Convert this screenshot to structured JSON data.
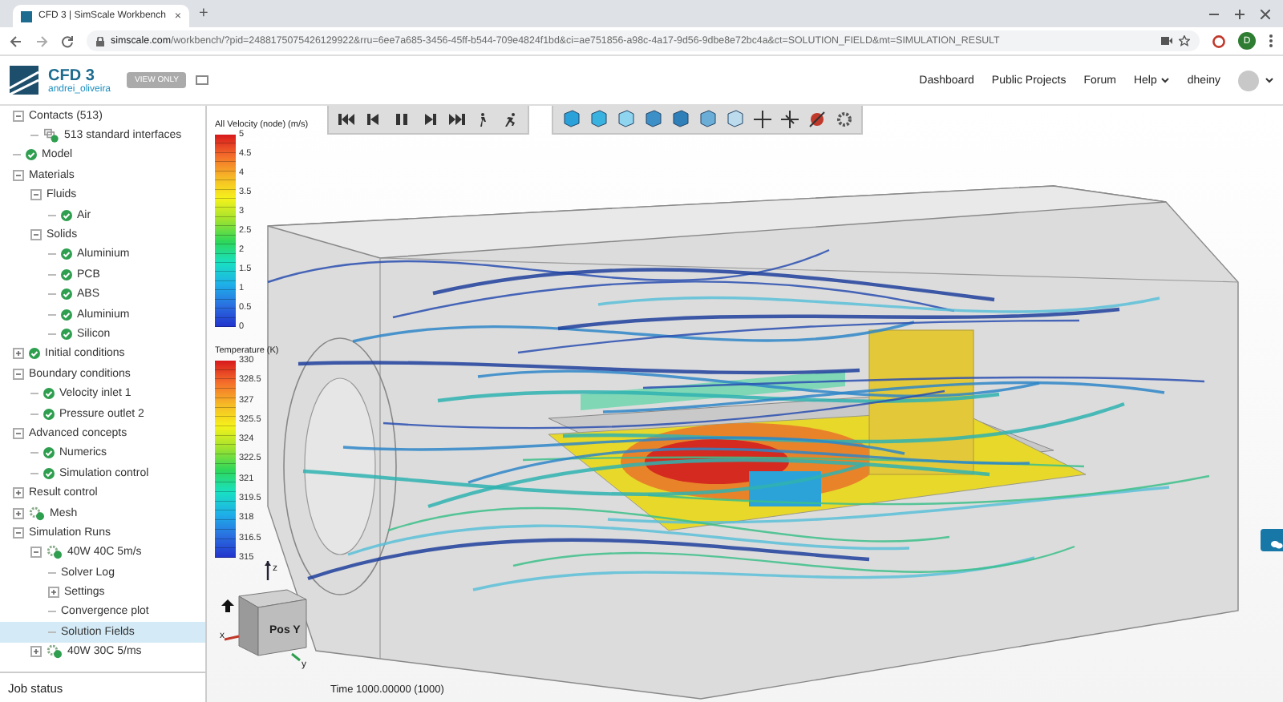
{
  "browser": {
    "tab_title": "CFD 3 | SimScale Workbench",
    "tab_close": "×",
    "new_tab": "+",
    "url_domain": "simscale.com",
    "url_path": "/workbench/?pid=2488175075426129922&rru=6ee7a685-3456-45ff-b544-709e4824f1bd&ci=ae751856-a98c-4a17-9d56-9dbe8e72bc4a&ct=SOLUTION_FIELD&mt=SIMULATION_RESULT",
    "profile_initial": "D"
  },
  "header": {
    "project": "CFD 3",
    "owner": "andrei_oliveira",
    "view_only": "VIEW ONLY",
    "nav": [
      "Dashboard",
      "Public Projects",
      "Forum",
      "Help"
    ],
    "user": "dheiny"
  },
  "tree": [
    {
      "label": "Contacts (513)",
      "kind": "plain",
      "expanded": true,
      "selected": false,
      "children": [
        {
          "label": "513 standard interfaces",
          "kind": "contacts",
          "selected": false
        }
      ]
    },
    {
      "label": "Model",
      "kind": "check",
      "selected": false
    },
    {
      "label": "Materials",
      "kind": "plain",
      "expanded": true,
      "selected": false,
      "children": [
        {
          "label": "Fluids",
          "kind": "plain",
          "expanded": true,
          "selected": false,
          "children": [
            {
              "label": "Air",
              "kind": "check",
              "selected": false
            }
          ]
        },
        {
          "label": "Solids",
          "kind": "plain",
          "expanded": true,
          "selected": false,
          "children": [
            {
              "label": "Aluminium",
              "kind": "check",
              "selected": false
            },
            {
              "label": "PCB",
              "kind": "check",
              "selected": false
            },
            {
              "label": "ABS",
              "kind": "check",
              "selected": false
            },
            {
              "label": "Aluminium",
              "kind": "check",
              "selected": false
            },
            {
              "label": "Silicon",
              "kind": "check",
              "selected": false
            }
          ]
        }
      ]
    },
    {
      "label": "Initial conditions",
      "kind": "check",
      "expanded": false,
      "selected": false
    },
    {
      "label": "Boundary conditions",
      "kind": "plain",
      "expanded": true,
      "selected": false,
      "children": [
        {
          "label": "Velocity inlet 1",
          "kind": "check",
          "selected": false
        },
        {
          "label": "Pressure outlet 2",
          "kind": "check",
          "selected": false
        }
      ]
    },
    {
      "label": "Advanced concepts",
      "kind": "plain",
      "expanded": true,
      "selected": false,
      "children": [
        {
          "label": "Numerics",
          "kind": "check",
          "selected": false
        },
        {
          "label": "Simulation control",
          "kind": "check",
          "selected": false
        }
      ]
    },
    {
      "label": "Result control",
      "kind": "plain",
      "expanded": false,
      "selected": false
    },
    {
      "label": "Mesh",
      "kind": "gear",
      "expanded": false,
      "selected": false
    },
    {
      "label": "Simulation Runs",
      "kind": "plain",
      "expanded": true,
      "selected": false,
      "children": [
        {
          "label": "40W 40C 5m/s",
          "kind": "gear",
          "expanded": true,
          "selected": false,
          "children": [
            {
              "label": "Solver Log",
              "kind": "plain",
              "selected": false
            },
            {
              "label": "Settings",
              "kind": "plain",
              "expanded": false,
              "selected": false
            },
            {
              "label": "Convergence plot",
              "kind": "plain",
              "selected": false
            },
            {
              "label": "Solution Fields",
              "kind": "plain",
              "selected": true
            }
          ]
        },
        {
          "label": "40W 30C 5/ms",
          "kind": "gear",
          "expanded": false,
          "selected": false
        }
      ]
    }
  ],
  "job_status": "Job status",
  "legends": [
    {
      "title": "All Velocity (node) (m/s)",
      "ticks": [
        "5",
        "4.5",
        "4",
        "3.5",
        "3",
        "2.5",
        "2",
        "1.5",
        "1",
        "0.5",
        "0"
      ]
    },
    {
      "title": "Temperature (K)",
      "ticks": [
        "330",
        "328.5",
        "327",
        "325.5",
        "324",
        "322.5",
        "321",
        "319.5",
        "318",
        "316.5",
        "315"
      ]
    }
  ],
  "orientation_cube": {
    "face": "Pos Y",
    "axes": [
      "z",
      "x",
      "y"
    ]
  },
  "time": "Time 1000.00000 (1000)"
}
